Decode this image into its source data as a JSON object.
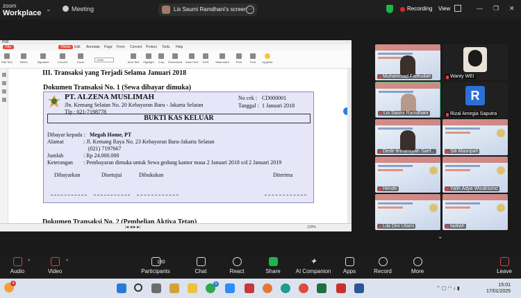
{
  "zoom": {
    "brand_top": "zoom",
    "brand_bottom": "Workplace",
    "meeting_label": "Meeting",
    "share_label": "Lis Saumi Ramdhani's screen",
    "recording_label": "Recording",
    "view_label": "View"
  },
  "colors": {
    "recording": "#e02828",
    "security": "#1fb34a",
    "accent": "#2f7fdb",
    "voucher_bg": "#e6e6f8"
  },
  "pdf": {
    "menu": [
      "File",
      "Home",
      "Edit",
      "Annotate",
      "Page",
      "Form",
      "Convert",
      "Protect",
      "Tools",
      "Help"
    ],
    "tools": [
      "Edit Text",
      "Select",
      "Signature",
      "Convert",
      "Zoom",
      "Area Text",
      "Highlight",
      "Crop",
      "Screenshot",
      "Insert Text",
      "OCR",
      "Watermark",
      "Print",
      "Find",
      "Upgrade"
    ],
    "zoom_value": "129%",
    "status_zoom": "129%",
    "section_title": "III. Transaksi yang Terjadi Selama Januari 2018",
    "doc1_title": "Dokumen Transaksi No. 1 (Sewa dibayar dimuka)",
    "doc2_title": "Dokumen Transaksi No. 2 (Pembelian Aktiva Tetap)",
    "voucher": {
      "company": "PT. ALZENA MUSLIMAH",
      "address": "Jln. Kemang Selatan No. 20 Kebayoran Baru - Jakarta Selatan",
      "phone": "Tlp : 021-7198778",
      "cek_label": "No cek :",
      "cek_value": "CD000001",
      "tanggal_label": "Tanggal :",
      "tanggal_value": "1 Januari 2018",
      "heading": "BUKTI KAS KELUAR",
      "dibayar_label": "Dibayar kepada :",
      "dibayar_value": "Megah Home, PT",
      "alamat_label": "Alamat",
      "alamat_value": ": Jl. Kemang Raya No. 23 Kebayoran Baru-Jakarta Selatan",
      "alamat_phone": "(021) 7197667",
      "jumlah_label": "Jumlah",
      "jumlah_value": ": Rp 24.000.000",
      "keterangan_label": "Keterangan",
      "keterangan_value": ": Pembayaran dimuka untuk Sewa gedung kantor masa 2 Januari 2018 s/d 2 Januari 2019",
      "signatures": [
        "Dibayarkan",
        "Disetujui",
        "Dibukukan",
        "Diterima"
      ]
    }
  },
  "participants": [
    {
      "name": "Muhammad Faithullah",
      "type": "poster"
    },
    {
      "name": "Wanty WEI",
      "type": "dark"
    },
    {
      "name": "Lis Saumi Ramdhani",
      "type": "poster"
    },
    {
      "name": "Rizal Amegia Saputra",
      "type": "avatar",
      "initial": "R"
    },
    {
      "name": "Dede firmansyah Saef...",
      "type": "poster"
    },
    {
      "name": "Siti Masripah",
      "type": "poster"
    },
    {
      "name": "Hendri",
      "type": "poster"
    },
    {
      "name": "Yalih Adya Wicaksono",
      "type": "poster"
    },
    {
      "name": "Lila Dini Utami",
      "type": "poster"
    },
    {
      "name": "fadilah",
      "type": "poster"
    }
  ],
  "controls": {
    "audio": "Audio",
    "video": "Video",
    "participants": "Participants",
    "participants_count": "180",
    "chat": "Chat",
    "react": "React",
    "share": "Share",
    "ai": "AI Companion",
    "apps": "Apps",
    "record": "Record",
    "more": "More",
    "leave": "Leave"
  },
  "taskbar": {
    "weather_badge": "4",
    "chat_badge": "5",
    "time": "15:01",
    "date": "17/01/2025"
  }
}
